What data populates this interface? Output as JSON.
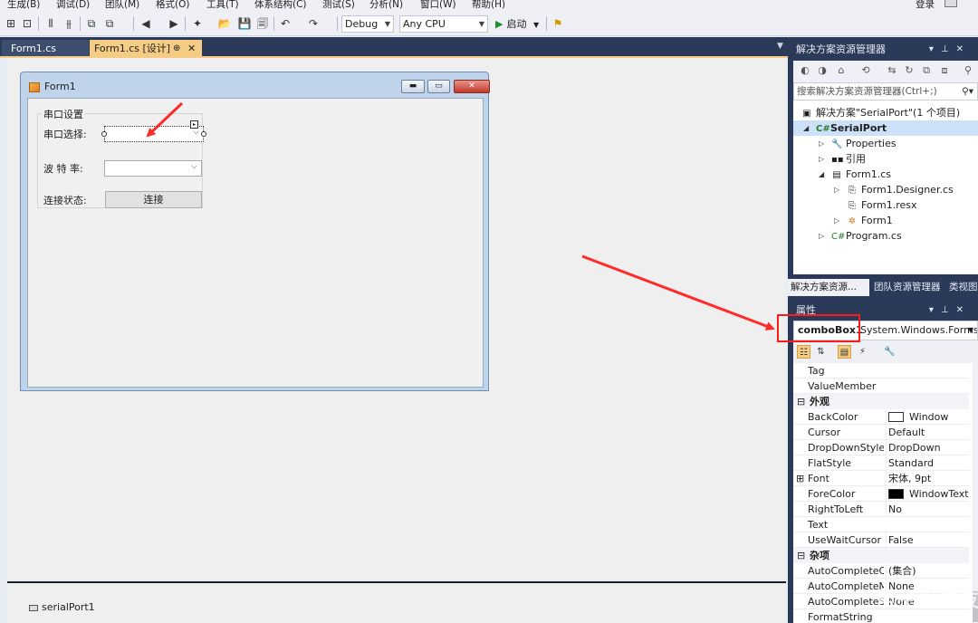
{
  "menubar": {
    "items": [
      "生成(B)",
      "调试(D)",
      "团队(M)",
      "格式(O)",
      "工具(T)",
      "体系结构(C)",
      "测试(S)",
      "分析(N)",
      "窗口(W)",
      "帮助(H)"
    ],
    "login": "登录"
  },
  "toolbar": {
    "config": "Debug",
    "platform": "Any CPU",
    "start": "启动"
  },
  "doc_tabs": {
    "tab1": "Form1.cs",
    "tab2": "Form1.cs [设计]",
    "tab2_pin": "⊕",
    "tab2_close": "✕"
  },
  "form1": {
    "title": "Form1",
    "min": "▬",
    "max": "▭",
    "close": "✕",
    "groupbox_title": "串口设置",
    "port_label": "串口选择:",
    "baud_label": "波 特 率:",
    "status_label": "连接状态:",
    "connect_button": "连接"
  },
  "tray": {
    "component": "serialPort1"
  },
  "solution_explorer": {
    "title": "解决方案资源管理器",
    "search_placeholder": "搜索解决方案资源管理器(Ctrl+;)",
    "nodes": [
      {
        "label": "解决方案\"SerialPort\"(1 个项目)"
      },
      {
        "label": "SerialPort"
      },
      {
        "label": "Properties"
      },
      {
        "label": "引用"
      },
      {
        "label": "Form1.cs"
      },
      {
        "label": "Form1.Designer.cs"
      },
      {
        "label": "Form1.resx"
      },
      {
        "label": "Form1"
      },
      {
        "label": "Program.cs"
      }
    ],
    "tabs": [
      "解决方案资源...",
      "团队资源管理器",
      "类视图"
    ]
  },
  "properties": {
    "title": "属性",
    "object_name": "comboBox1",
    "object_type": "System.Windows.Forms",
    "rows": [
      {
        "name": "Tag",
        "value": ""
      },
      {
        "name": "ValueMember",
        "value": ""
      },
      {
        "category": "外观"
      },
      {
        "name": "BackColor",
        "value": "Window",
        "swatch": "#ffffff"
      },
      {
        "name": "Cursor",
        "value": "Default"
      },
      {
        "name": "DropDownStyle",
        "value": "DropDown"
      },
      {
        "name": "FlatStyle",
        "value": "Standard"
      },
      {
        "name": "Font",
        "value": "宋体, 9pt",
        "expandable": true
      },
      {
        "name": "ForeColor",
        "value": "WindowText",
        "swatch": "#000000"
      },
      {
        "name": "RightToLeft",
        "value": "No"
      },
      {
        "name": "Text",
        "value": ""
      },
      {
        "name": "UseWaitCursor",
        "value": "False"
      },
      {
        "category": "杂项"
      },
      {
        "name": "AutoCompleteC",
        "value": "(集合)"
      },
      {
        "name": "AutoCompleteM",
        "value": "None"
      },
      {
        "name": "AutoCompleteS",
        "value": "None"
      },
      {
        "name": "FormatString",
        "value": ""
      }
    ]
  },
  "watermark": "电子发烧友网",
  "colors": {
    "vs_frame": "#2b3a58",
    "active_tab": "#f5cc84",
    "annotation_red": "#ff1a1a"
  }
}
